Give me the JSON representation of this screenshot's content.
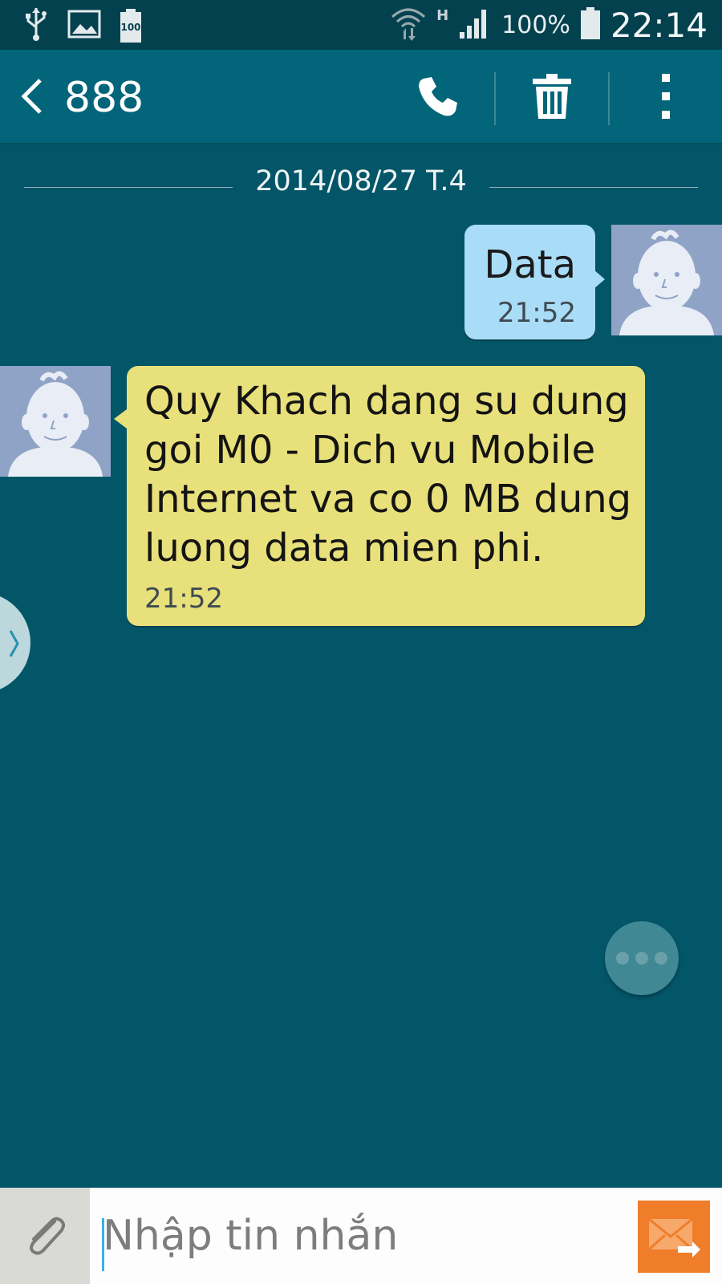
{
  "status_bar": {
    "battery_saver_label": "100",
    "network_type": "H",
    "battery_percent": "100%",
    "time": "22:14",
    "icons": [
      "usb-icon",
      "gallery-icon",
      "battery-saver-icon",
      "wifi-icon",
      "signal-icon",
      "battery-icon"
    ]
  },
  "action_bar": {
    "title": "888",
    "icons": [
      "back-arrow-icon",
      "phone-icon",
      "trash-icon",
      "more-vertical-icon"
    ]
  },
  "conversation": {
    "date_header": "2014/08/27 T.4",
    "messages": [
      {
        "direction": "outgoing",
        "text": "Data",
        "time": "21:52"
      },
      {
        "direction": "incoming",
        "text": "Quy Khach dang su dung goi M0 - Dich vu Mobile Internet va co 0 MB dung luong data mien phi.",
        "time": "21:52"
      }
    ]
  },
  "compose": {
    "placeholder": "Nhập tin nhắn",
    "icons": [
      "paperclip-icon",
      "send-icon"
    ]
  },
  "colors": {
    "background": "#035568",
    "action_bar": "#026579",
    "outgoing_bubble": "#a9dcf7",
    "incoming_bubble": "#e8e07a",
    "send_button": "#f07d2a"
  }
}
